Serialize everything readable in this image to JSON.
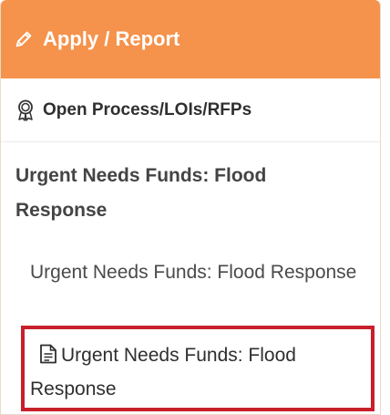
{
  "header": {
    "title": "Apply / Report",
    "icon": "pencil-icon",
    "background_color": "#f5924b"
  },
  "section": {
    "title": "Open Process/LOIs/RFPs",
    "icon": "award-icon"
  },
  "fund": {
    "title": "Urgent Needs Funds: Flood Response",
    "sub_item_label": "Urgent Needs Funds: Flood Response",
    "document_label": "Urgent Needs Funds: Flood Response",
    "document_icon": "document-icon",
    "highlight_color": "#c8202a"
  }
}
